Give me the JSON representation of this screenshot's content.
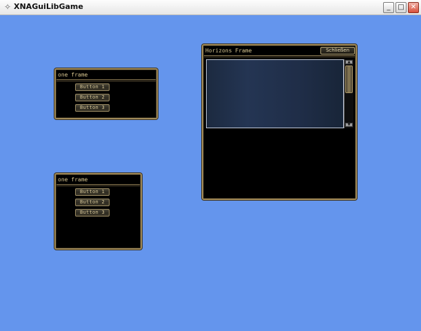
{
  "window": {
    "title": "XNAGuiLibGame",
    "controls": {
      "minimize": "_",
      "maximize": "□",
      "close": "✕"
    }
  },
  "frames": [
    {
      "title": "one frame",
      "buttons": [
        "Button 1",
        "Button 2",
        "Button 3"
      ]
    },
    {
      "title": "one frame",
      "buttons": [
        "Button 1",
        "Button 2",
        "Button 3"
      ]
    },
    {
      "title": "Horizons Frame",
      "close_label": "Schließen"
    }
  ],
  "colors": {
    "desktop_background": "#6495ED",
    "frame_border": "#a08a5a",
    "frame_text": "#d8c690"
  }
}
